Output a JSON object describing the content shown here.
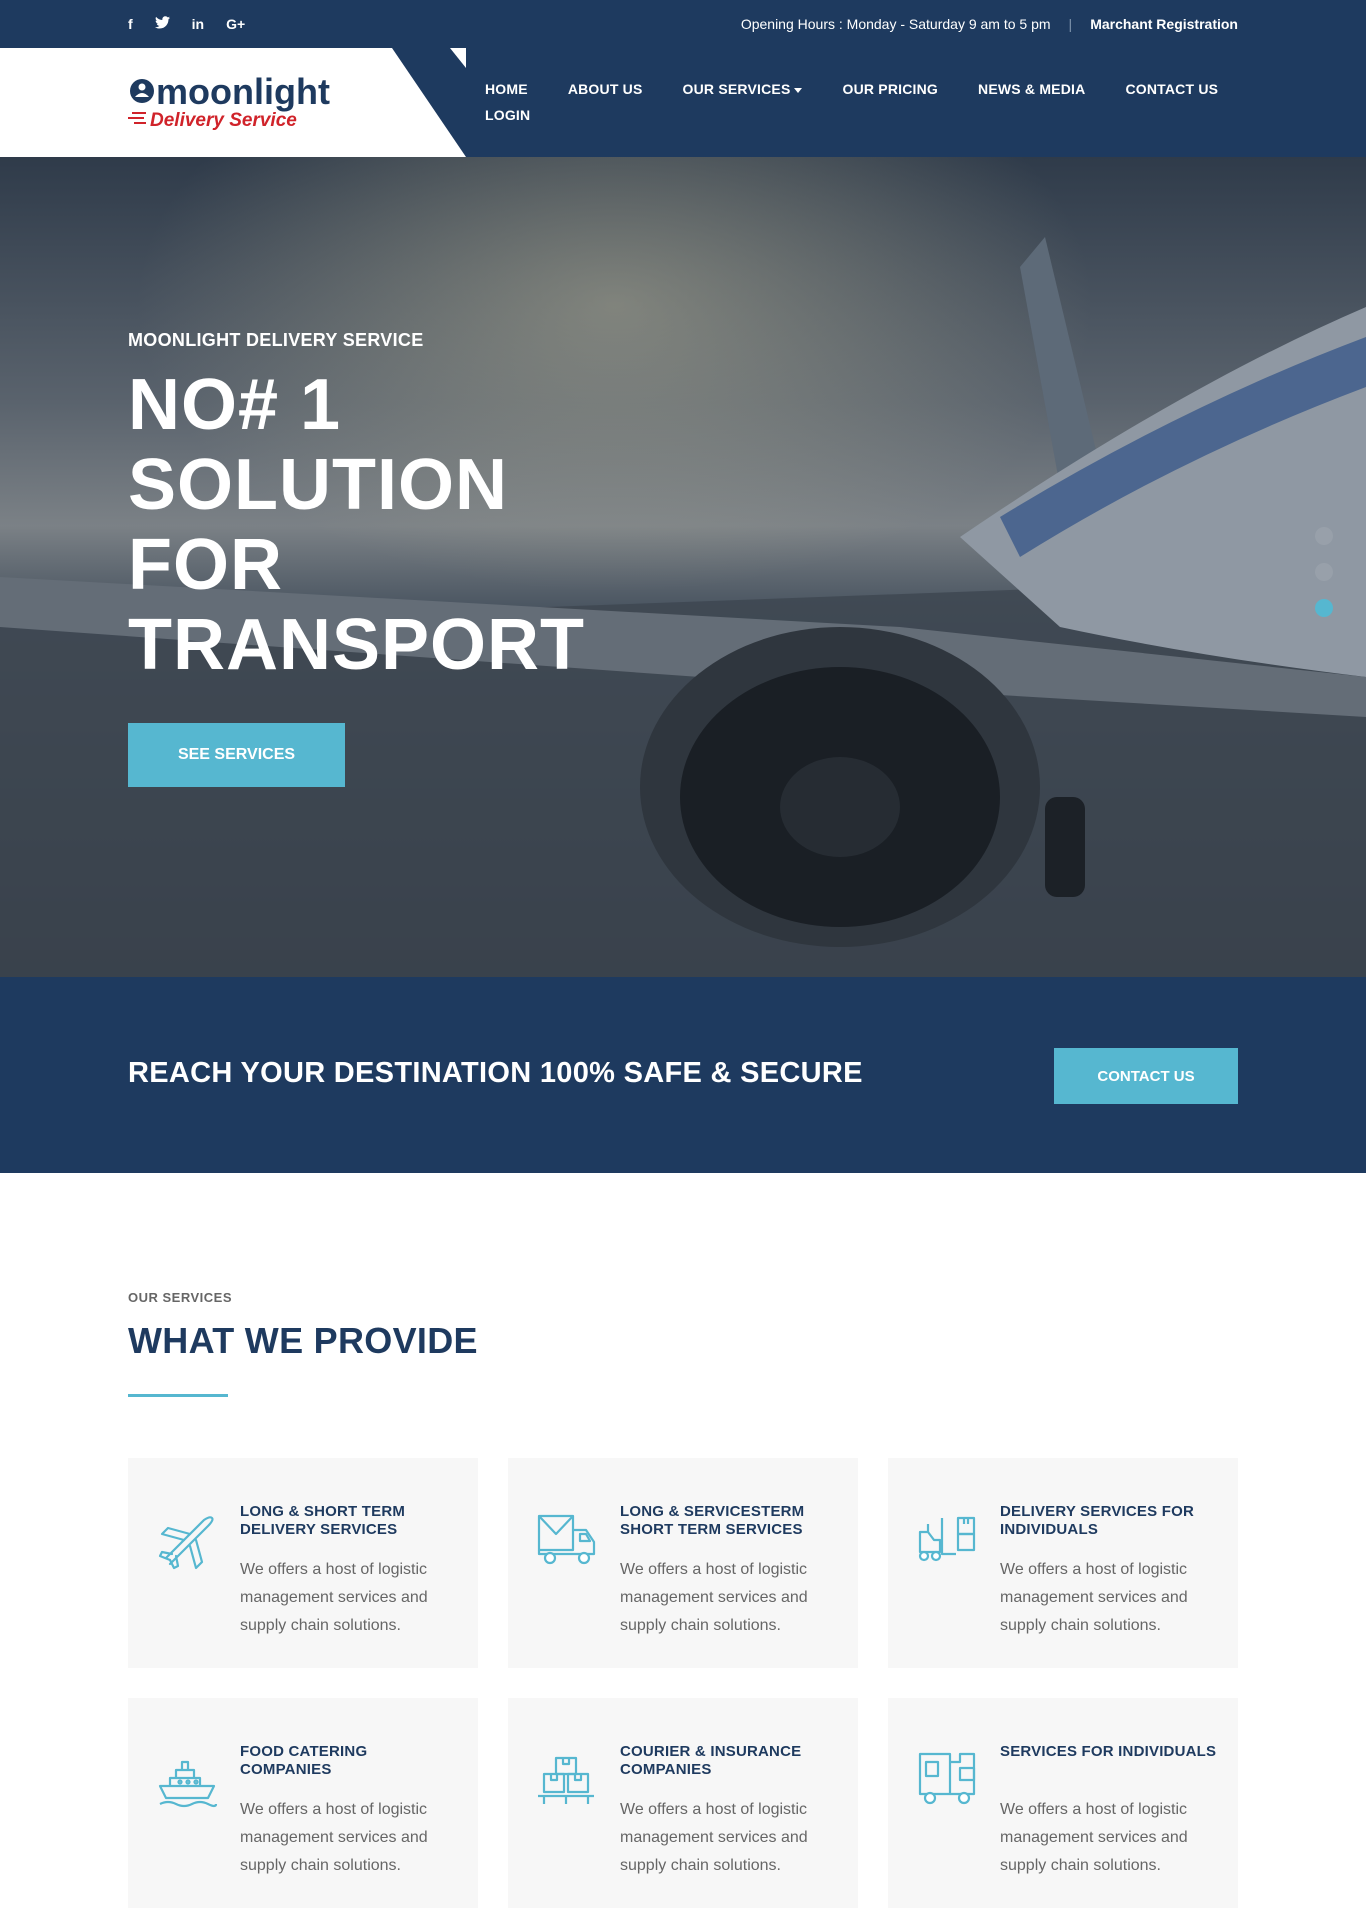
{
  "topbar": {
    "social": [
      {
        "icon": "facebook-icon",
        "glyph": "f"
      },
      {
        "icon": "twitter-icon",
        "glyph": "t"
      },
      {
        "icon": "linkedin-icon",
        "glyph": "in"
      },
      {
        "icon": "google-plus-icon",
        "glyph": "G+"
      }
    ],
    "hours": "Opening Hours : Monday - Saturday 9 am to 5 pm",
    "separator": "|",
    "registration": "Marchant Registration"
  },
  "brand": {
    "name": "moonlight",
    "tagline": "Delivery Service",
    "colors": {
      "navy": "#1e3a5f",
      "red": "#d0232a",
      "accent": "#56b7d0"
    }
  },
  "nav": {
    "home": "HOME",
    "about": "ABOUT US",
    "services": "OUR SERVICES",
    "pricing": "OUR PRICING",
    "news": "NEWS & MEDIA",
    "contact": "CONTACT US",
    "login": "LOGIN"
  },
  "hero": {
    "subtitle": "MOONLIGHT DELIVERY SERVICE",
    "title_lines": [
      "NO# 1",
      "SOLUTION",
      "FOR",
      "TRANSPORT"
    ],
    "button": "SEE SERVICES",
    "slides": 3,
    "active_slide": 3
  },
  "cta": {
    "text": "REACH YOUR DESTINATION 100% SAFE & SECURE",
    "button": "CONTACT US"
  },
  "services": {
    "eyebrow": "OUR SERVICES",
    "title": "WHAT WE PROVIDE",
    "items": [
      {
        "icon": "airplane-icon",
        "title": "LONG & SHORT TERM DELIVERY SERVICES",
        "desc": "We offers a host of logistic management services and supply chain solutions."
      },
      {
        "icon": "delivery-truck-icon",
        "title": "LONG & SERVICESTERM SHORT TERM SERVICES",
        "desc": "We offers a host of logistic management services and supply chain solutions."
      },
      {
        "icon": "forklift-icon",
        "title": "DELIVERY SERVICES FOR INDIVIDUALS",
        "desc": "We offers a host of logistic management services and supply chain solutions."
      },
      {
        "icon": "ship-icon",
        "title": "FOOD CATERING COMPANIES",
        "desc": "We offers a host of logistic management services and supply chain solutions."
      },
      {
        "icon": "boxes-icon",
        "title": "COURIER & INSURANCE COMPANIES",
        "desc": "We offers a host of logistic management services and supply chain solutions."
      },
      {
        "icon": "cargo-truck-icon",
        "title": "SERVICES FOR INDIVIDUALS",
        "desc": "We offers a host of logistic management services and supply chain solutions."
      }
    ]
  }
}
